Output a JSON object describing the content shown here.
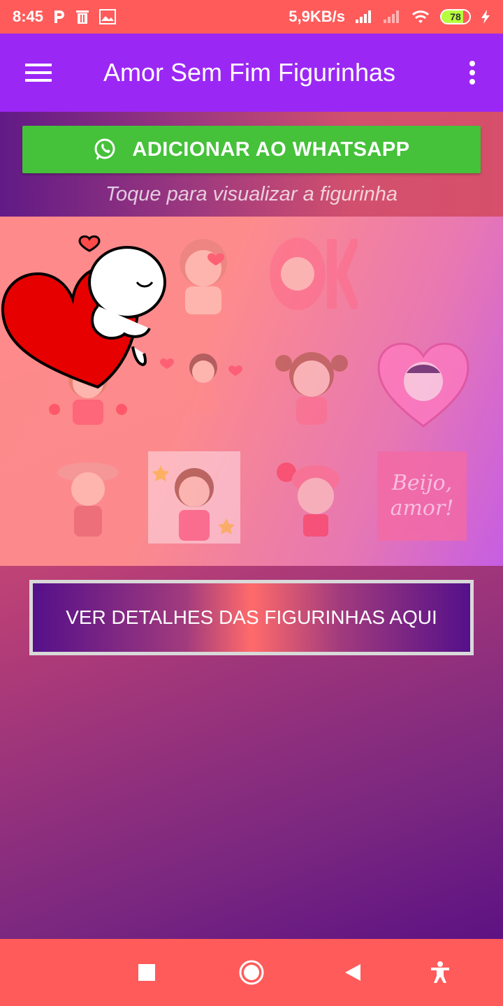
{
  "status_bar": {
    "time": "8:45",
    "network_speed": "5,9KB/s",
    "battery_level": "78",
    "icons_left": [
      "p-icon",
      "trash-icon",
      "image-icon"
    ],
    "icons_right": [
      "signal-icon",
      "signal-weak-icon",
      "wifi-icon",
      "battery-icon",
      "charging-icon"
    ]
  },
  "app_bar": {
    "title": "Amor Sem Fim Figurinhas",
    "menu_icon": "menu-icon",
    "more_icon": "more-vert-icon"
  },
  "actions": {
    "add_whatsapp_label": "ADICIONAR AO WHATSAPP",
    "hint": "Toque para visualizar a figurinha",
    "details_label": "VER DETALHES DAS FIGURINHAS AQUI"
  },
  "stickers": {
    "beijo_line1": "Beijo,",
    "beijo_line2": "amor!",
    "ok_text": "OK"
  },
  "nav_bar": {
    "icons": [
      "recents-icon",
      "home-icon",
      "back-icon",
      "accessibility-icon"
    ]
  },
  "colors": {
    "status_bar": "#ff5b5b",
    "app_bar": "#9b27f5",
    "whatsapp_green": "#45c13a"
  }
}
